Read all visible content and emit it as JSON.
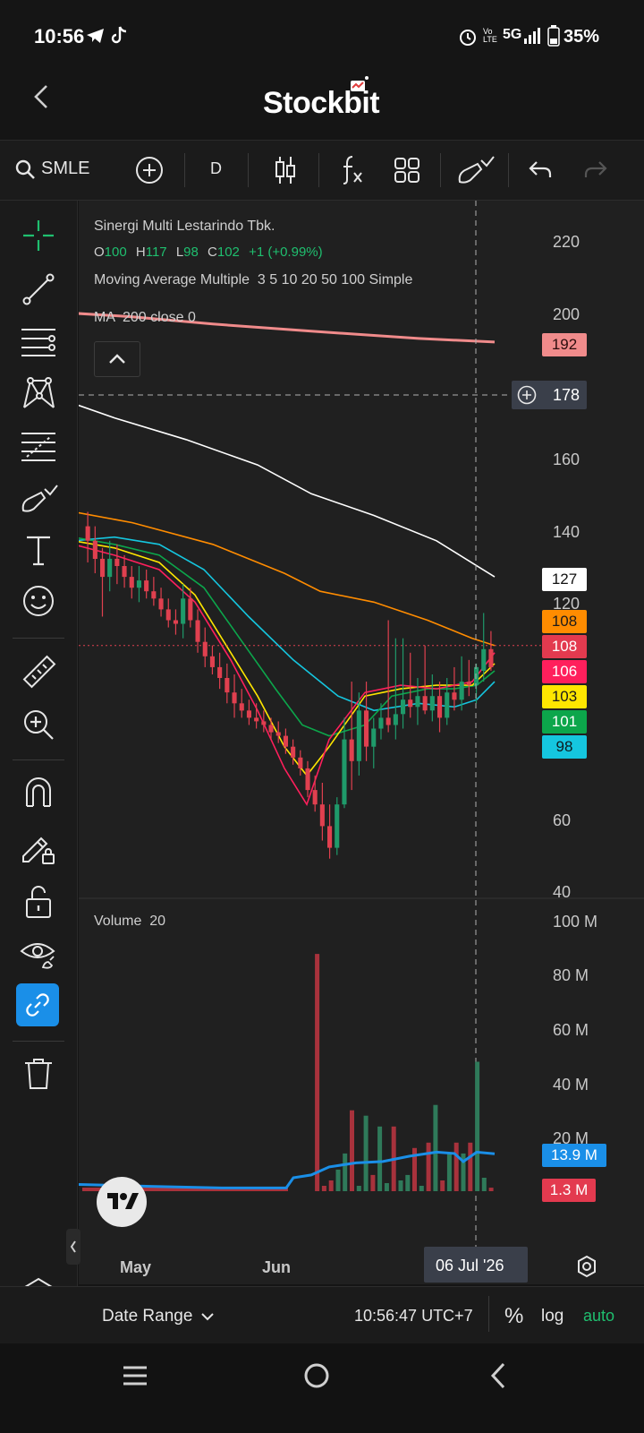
{
  "status": {
    "time": "10:56",
    "battery": "35%",
    "network": "5G",
    "volte": "Vo LTE"
  },
  "header": {
    "brand": "Stockbit",
    "back_icon": "chevron-left-icon"
  },
  "toolbar": {
    "symbol": "SMLE",
    "interval": "D"
  },
  "legend": {
    "name": "Sinergi Multi Lestarindo Tbk.",
    "o_label": "O",
    "o_value": "100",
    "h_label": "H",
    "h_value": "117",
    "l_label": "L",
    "l_value": "98",
    "c_label": "C",
    "c_value": "102",
    "change": "+1 (+0.99%)",
    "ma_multi": "Moving Average Multiple  3 5 10 20 50 100 Simple",
    "ma_200": "MA  200 close 0",
    "volume": "Volume  20"
  },
  "axis": {
    "price_ticks": [
      "220",
      "200",
      "160",
      "140",
      "120",
      "60",
      "40"
    ],
    "volume_ticks": [
      "100 M",
      "80 M",
      "60 M",
      "40 M",
      "20 M"
    ],
    "months": [
      "May",
      "Jun"
    ],
    "crosshair_date": "06 Jul '26",
    "crosshair_price": "178"
  },
  "price_tags": [
    {
      "value": "192",
      "bg": "#f08b8b",
      "fg": "#2a0d0d"
    },
    {
      "value": "127",
      "bg": "#ffffff",
      "fg": "#111111"
    },
    {
      "value": "108",
      "bg": "#ff8c00",
      "fg": "#1b1b1b"
    },
    {
      "value": "108",
      "bg": "#e33a4f",
      "fg": "#ffffff"
    },
    {
      "value": "106",
      "bg": "#ff1f5c",
      "fg": "#ffffff"
    },
    {
      "value": "103",
      "bg": "#ffe600",
      "fg": "#1b1b1b"
    },
    {
      "value": "101",
      "bg": "#0ca64b",
      "fg": "#ffffff"
    },
    {
      "value": "98",
      "bg": "#15c6df",
      "fg": "#0d1b1f"
    }
  ],
  "volume_tags": [
    {
      "value": "13.9 M",
      "bg": "#1a8fe8",
      "fg": "#ffffff"
    },
    {
      "value": "1.3 M",
      "bg": "#e33a4f",
      "fg": "#ffffff"
    }
  ],
  "bottom": {
    "date_range": "Date Range",
    "clock": "10:56:47 UTC+7",
    "percent": "%",
    "log": "log",
    "auto": "auto"
  },
  "colors": {
    "up": "#1f9a6a",
    "down": "#e0404f",
    "accent": "#1a8fe8",
    "auto": "#1fbf6f"
  },
  "chart_data": {
    "type": "candlestick",
    "title": "Sinergi Multi Lestarindo Tbk.",
    "x_labels": [
      "May",
      "Jun"
    ],
    "ylim": [
      40,
      220
    ],
    "candles": [
      [
        141,
        145,
        131,
        137
      ],
      [
        137,
        141,
        128,
        132
      ],
      [
        132,
        135,
        116,
        127
      ],
      [
        127,
        137,
        123,
        132
      ],
      [
        132,
        136,
        125,
        130
      ],
      [
        130,
        133,
        124,
        127
      ],
      [
        127,
        130,
        121,
        124
      ],
      [
        124,
        130,
        120,
        126
      ],
      [
        126,
        129,
        121,
        123
      ],
      [
        123,
        127,
        119,
        121
      ],
      [
        121,
        124,
        116,
        118
      ],
      [
        118,
        121,
        113,
        115
      ],
      [
        115,
        118,
        111,
        114
      ],
      [
        114,
        125,
        110,
        121
      ],
      [
        121,
        124,
        113,
        115
      ],
      [
        115,
        118,
        106,
        109
      ],
      [
        109,
        113,
        102,
        105
      ],
      [
        105,
        108,
        100,
        102
      ],
      [
        102,
        106,
        96,
        99
      ],
      [
        99,
        103,
        92,
        95
      ],
      [
        95,
        100,
        88,
        92
      ],
      [
        92,
        96,
        88,
        90
      ],
      [
        90,
        93,
        86,
        88
      ],
      [
        88,
        92,
        85,
        87
      ],
      [
        87,
        90,
        84,
        86
      ],
      [
        86,
        88,
        82,
        84
      ],
      [
        84,
        87,
        81,
        83
      ],
      [
        83,
        85,
        78,
        80
      ],
      [
        80,
        82,
        75,
        77
      ],
      [
        77,
        79,
        72,
        74
      ],
      [
        74,
        76,
        66,
        68
      ],
      [
        68,
        72,
        62,
        64
      ],
      [
        64,
        70,
        54,
        58
      ],
      [
        58,
        64,
        49,
        52
      ],
      [
        52,
        66,
        50,
        64
      ],
      [
        64,
        88,
        63,
        82
      ],
      [
        82,
        98,
        68,
        76
      ],
      [
        76,
        95,
        72,
        90
      ],
      [
        90,
        98,
        76,
        80
      ],
      [
        80,
        88,
        74,
        85
      ],
      [
        85,
        92,
        82,
        88
      ],
      [
        88,
        115,
        84,
        86
      ],
      [
        86,
        110,
        82,
        89
      ],
      [
        89,
        110,
        85,
        93
      ],
      [
        93,
        106,
        88,
        91
      ],
      [
        91,
        99,
        86,
        94
      ],
      [
        94,
        108,
        89,
        90
      ],
      [
        90,
        100,
        87,
        94
      ],
      [
        94,
        98,
        84,
        88
      ],
      [
        88,
        99,
        86,
        95
      ],
      [
        95,
        102,
        90,
        93
      ],
      [
        93,
        105,
        90,
        98
      ],
      [
        98,
        104,
        94,
        97
      ],
      [
        97,
        103,
        92,
        102
      ],
      [
        101,
        117,
        98,
        107
      ],
      [
        107,
        112,
        101,
        102
      ]
    ],
    "ma_lines": [
      {
        "name": "MA 200",
        "color": "#f08b8b",
        "values": [
          200,
          192
        ]
      },
      {
        "name": "MA 100",
        "color": "#ffffff",
        "values": [
          175,
          127
        ]
      },
      {
        "name": "MA 50",
        "color": "#ff8c00",
        "values": [
          145,
          108
        ]
      },
      {
        "name": "MA 20",
        "color": "#15c6df",
        "values": [
          138,
          98
        ]
      },
      {
        "name": "MA 10",
        "color": "#0ca64b",
        "values": [
          137,
          101
        ]
      },
      {
        "name": "MA 5",
        "color": "#ffe600",
        "values": [
          136,
          103
        ]
      },
      {
        "name": "MA 3",
        "color": "#ff1f5c",
        "values": [
          135,
          106
        ]
      }
    ],
    "volume": {
      "ylim": [
        0,
        100
      ],
      "unit": "M",
      "bars": [
        0,
        0,
        0,
        0,
        0,
        0,
        0,
        0,
        0,
        0,
        0,
        0,
        0,
        0,
        0,
        0,
        0,
        0,
        0,
        0,
        0,
        0,
        0,
        0,
        0,
        0,
        0,
        0,
        0,
        0,
        0,
        0,
        0,
        88,
        2,
        4,
        8,
        14,
        30,
        2,
        28,
        6,
        24,
        3,
        24,
        4,
        6,
        16,
        2,
        18,
        32,
        4,
        14,
        18,
        14,
        18,
        48,
        5,
        1.3
      ],
      "ma_line": [
        1.5,
        1.6,
        13.9
      ]
    }
  }
}
